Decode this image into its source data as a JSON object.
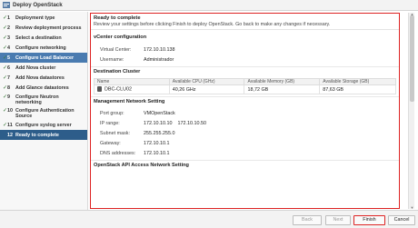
{
  "window": {
    "title": "Deploy OpenStack"
  },
  "steps": [
    {
      "num": "1",
      "label": "Deployment type",
      "done": true
    },
    {
      "num": "2",
      "label": "Review deployment process",
      "done": true
    },
    {
      "num": "3",
      "label": "Select a destination",
      "done": true
    },
    {
      "num": "4",
      "label": "Configure networking",
      "done": true
    },
    {
      "num": "5",
      "label": "Configure Load Balancer",
      "done": true
    },
    {
      "num": "6",
      "label": "Add Nova cluster",
      "done": true
    },
    {
      "num": "7",
      "label": "Add Nova datastores",
      "done": true
    },
    {
      "num": "8",
      "label": "Add Glance datastores",
      "done": true
    },
    {
      "num": "9",
      "label": "Configure Neutron",
      "label2": "networking",
      "done": true
    },
    {
      "num": "10",
      "label": "Configure Authentication",
      "label2": "Source",
      "done": true
    },
    {
      "num": "11",
      "label": "Configure syslog server",
      "done": true
    },
    {
      "num": "12",
      "label": "Ready to complete",
      "done": false
    }
  ],
  "main": {
    "heading": "Ready to complete",
    "subheading": "Review your settings before clicking Finish to deploy OpenStack. Go back to make any changes if necessary.",
    "vcenter": {
      "title": "vCenter configuration",
      "rows": [
        {
          "k": "Virtual Center:",
          "v": "172.10.10.138"
        },
        {
          "k": "Username:",
          "v": "Administrador"
        }
      ]
    },
    "cluster": {
      "title": "Destination Cluster",
      "columns": [
        "Name",
        "Available CPU (GHz)",
        "Available Memory (GB)",
        "Available Storage (GB)"
      ],
      "row": [
        "DBC-CLU02",
        "40,26 GHz",
        "18,72 GB",
        "87,63 GB"
      ]
    },
    "mgmt": {
      "title": "Management Network Setting",
      "rows": [
        {
          "k": "Port group:",
          "v": "VMOpenStack"
        },
        {
          "k": "IP range:",
          "v": "172.10.10.10    172.10.10.50"
        },
        {
          "k": "Subnet mask:",
          "v": "255.255.255.0"
        },
        {
          "k": "Gateway:",
          "v": "172.10.10.1"
        },
        {
          "k": "DNS addresses:",
          "v": "172.10.10.1"
        }
      ]
    },
    "api": {
      "title": "OpenStack API Access Network Setting"
    }
  },
  "footer": {
    "back": "Back",
    "next": "Next",
    "finish": "Finish",
    "cancel": "Cancel"
  },
  "colors": {
    "selected": "#2d5d8a",
    "highlight": "#dd2222"
  }
}
